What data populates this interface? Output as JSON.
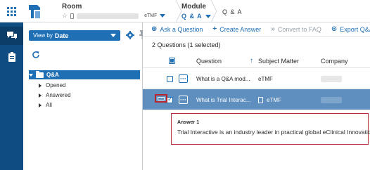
{
  "header": {
    "room_label": "Room",
    "room_tag": "eTMF",
    "module_label": "Module",
    "module_value": "Q & A",
    "page_crumb": "Q & A"
  },
  "tree": {
    "viewby_prefix": "View by",
    "viewby_value": "Date",
    "root": "Q&A",
    "children": [
      "Opened",
      "Answered",
      "All"
    ]
  },
  "toolbar": {
    "ask": "Ask a Question",
    "create": "Create Answer",
    "convert": "Convert to FAQ",
    "export": "Export Q&A"
  },
  "grid": {
    "count_text": "2 Questions (1 selected)",
    "columns": [
      "Question",
      "Subject Matter",
      "Company"
    ],
    "rows": [
      {
        "question": "What is a Q&A mod...",
        "subject": "eTMF"
      },
      {
        "question": "What is Trial Interac...",
        "subject": "eTMF"
      }
    ]
  },
  "answer": {
    "title": "Answer 1",
    "text": "Trial Interactive is an industry leader in practical global eClinical Innovation"
  },
  "colors": {
    "primary": "#1f6fb5",
    "rail": "#0f4c81",
    "selected_row": "#5e8fbf",
    "highlight": "#b8262b"
  }
}
